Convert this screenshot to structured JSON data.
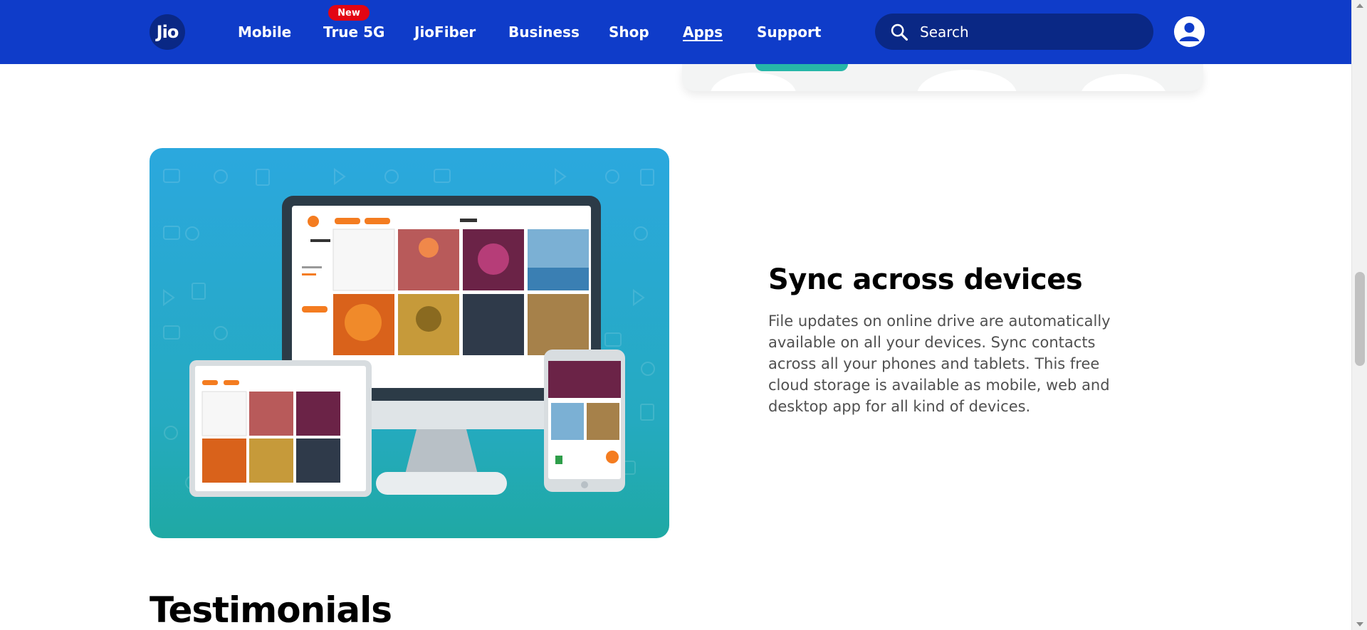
{
  "header": {
    "logo_text": "Jio",
    "nav": [
      {
        "label": "Mobile",
        "active": false
      },
      {
        "label": "True 5G",
        "active": false,
        "badge": "New"
      },
      {
        "label": "JioFiber",
        "active": false
      },
      {
        "label": "Business",
        "active": false
      },
      {
        "label": "Shop",
        "active": false
      },
      {
        "label": "Apps",
        "active": true
      },
      {
        "label": "Support",
        "active": false
      }
    ],
    "search_placeholder": "Search",
    "profile_icon": "user-icon",
    "search_icon": "search-icon"
  },
  "feature": {
    "title": "Sync across devices",
    "description": "File updates on online drive are automatically available on all your devices. Sync contacts across all your phones and tablets. This free cloud storage is available as mobile, web and desktop app for all kind of devices."
  },
  "testimonials_heading": "Testimonials",
  "colors": {
    "header_bg": "#0f3cc9",
    "search_bg": "#0a2885",
    "badge_red": "#e30513",
    "image_blue": "#2ba8de",
    "image_teal": "#1fa9a4",
    "accent_orange": "#f47c20"
  }
}
